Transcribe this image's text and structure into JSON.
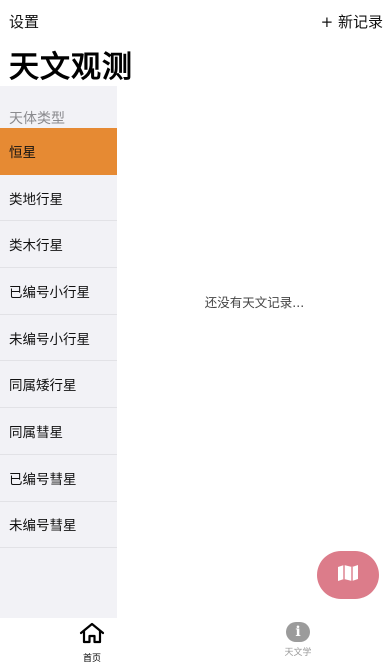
{
  "header": {
    "settings_label": "设置",
    "new_record_label": "+ 新记录",
    "title": "天文观测"
  },
  "sidebar": {
    "section_title": "天体类型",
    "selected_index": 0,
    "items": [
      {
        "label": "恒星"
      },
      {
        "label": "类地行星"
      },
      {
        "label": "类木行星"
      },
      {
        "label": "已编号小行星"
      },
      {
        "label": "未编号小行星"
      },
      {
        "label": "同属矮行星"
      },
      {
        "label": "同属彗星"
      },
      {
        "label": "已编号彗星"
      },
      {
        "label": "未编号彗星"
      }
    ]
  },
  "main": {
    "empty_message": "还没有天文记录..."
  },
  "fab": {
    "icon": "map-icon",
    "color": "#dc7c8a"
  },
  "tabbar": {
    "tabs": [
      {
        "label": "首页",
        "icon": "home-icon",
        "active": true
      },
      {
        "label": "天文学",
        "icon": "info-icon",
        "active": false
      }
    ]
  },
  "colors": {
    "accent": "#e68a33",
    "sidebar_bg": "#f2f2f6",
    "fab": "#dc7c8a"
  }
}
